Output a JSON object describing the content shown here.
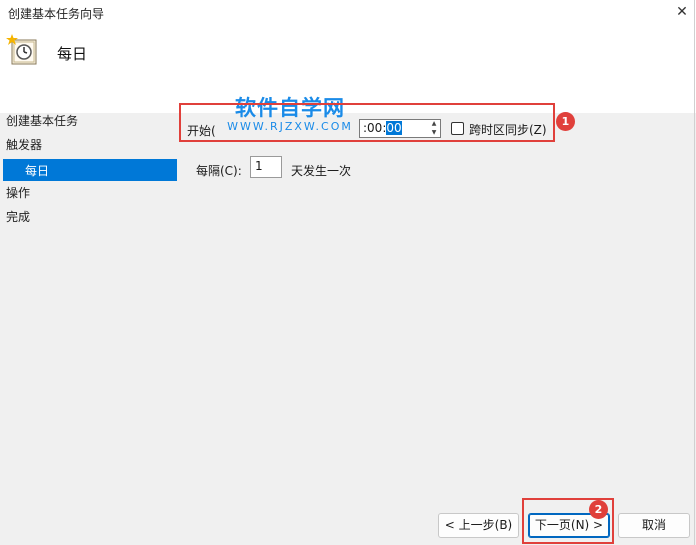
{
  "window": {
    "title": "创建基本任务向导",
    "close_glyph": "✕"
  },
  "header": {
    "title": "每日",
    "icon": "scheduled-task-clock-icon"
  },
  "steps": [
    {
      "label": "创建基本任务"
    },
    {
      "label": "触发器"
    },
    {
      "label": "每日",
      "selected": true
    },
    {
      "label": "操作"
    },
    {
      "label": "完成"
    }
  ],
  "trigger": {
    "start_label": "开始(",
    "time_value_pre": ":00:",
    "time_value_sel": "00",
    "sync_label": "跨时区同步(Z)",
    "sync_checked": false,
    "every_label": "每隔(C):",
    "every_value": "1",
    "every_unit": "天发生一次"
  },
  "annotations": {
    "watermark_title": "软件自学网",
    "watermark_url": "WWW.RJZXW.COM",
    "badge1": "1",
    "badge2": "2",
    "color": "#e0403b"
  },
  "buttons": {
    "back": "< 上一步(B)",
    "next": "下一页(N) >",
    "cancel": "取消"
  },
  "colors": {
    "selection": "#0078d7",
    "background": "#f0f0f0",
    "header": "#ffffff"
  }
}
